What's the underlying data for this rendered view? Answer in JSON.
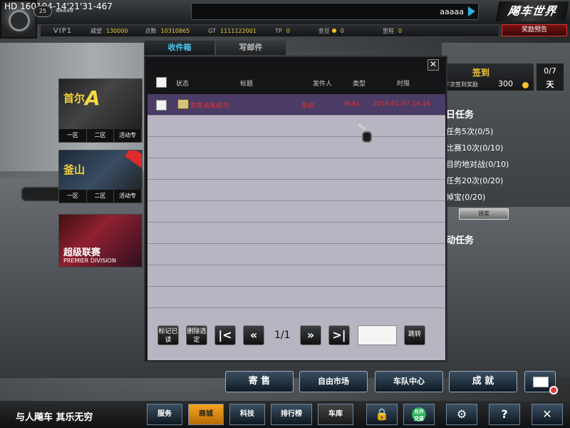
{
  "topbar": {
    "hd_text": "HD 160104-14'21'31-467",
    "level": "25",
    "player_name": "aaaaa",
    "chat_text": "aaaaa",
    "logo": "飚车世界"
  },
  "stats": {
    "vip": "VIP1",
    "prestige_label": "威望",
    "prestige_value": "130000",
    "points_label": "点数",
    "points_value": "10310865",
    "gt_label": "GT",
    "gt_value": "1111122001",
    "tp_label": "TP",
    "tp_value": "0",
    "gold_label": "金豆",
    "gold_value": "0",
    "mileage_label": "里程",
    "mileage_value": "0",
    "reward_preview": "奖励预告"
  },
  "ads": {
    "seoul": {
      "title": "首尔",
      "tabs": [
        "一区",
        "二区",
        "活动专"
      ]
    },
    "busan": {
      "title": "釜山",
      "tabs": [
        "一区",
        "二区",
        "活动专"
      ]
    },
    "league": {
      "title": "超级联赛",
      "subtitle": "PREMIER DIVISION"
    }
  },
  "daily": {
    "checkin": "签到",
    "next_reward_label": "下次签到奖励",
    "next_reward_value": "300",
    "days_count": "0/7",
    "days_unit": "天",
    "section_title": "日任务",
    "quests": [
      "任务5次(0/5)",
      "比赛10次(0/10)",
      "目的地对战(0/10)",
      "任务20次(0/20)",
      "掉宝(0/20)"
    ],
    "claim": "领奖",
    "section2_title": "动任务"
  },
  "mail": {
    "tabs": [
      "收件箱",
      "写邮件"
    ],
    "columns": {
      "status": "状态",
      "title": "标题",
      "sender": "发件人",
      "type": "类型",
      "time": "时限"
    },
    "rows": [
      {
        "title": "寄售道具成功",
        "sender": "系统",
        "type": "NULL",
        "time": "2016-01-07 14:16"
      }
    ],
    "mark_read": "标记已读",
    "delete_selected": "删除选定",
    "page": "1/1",
    "jump": "跳转",
    "close": "✕"
  },
  "actions": {
    "consign": "寄 售",
    "free_market": "自由市场",
    "team_center": "车队中心",
    "achievement": "成 就"
  },
  "bottombar": {
    "slogan": "与人飚车 其乐无穷",
    "service": "服务",
    "mall": "商城",
    "tech": "科技",
    "ranking": "排行榜",
    "garage": "车库",
    "allow_trade": "允许交易"
  }
}
